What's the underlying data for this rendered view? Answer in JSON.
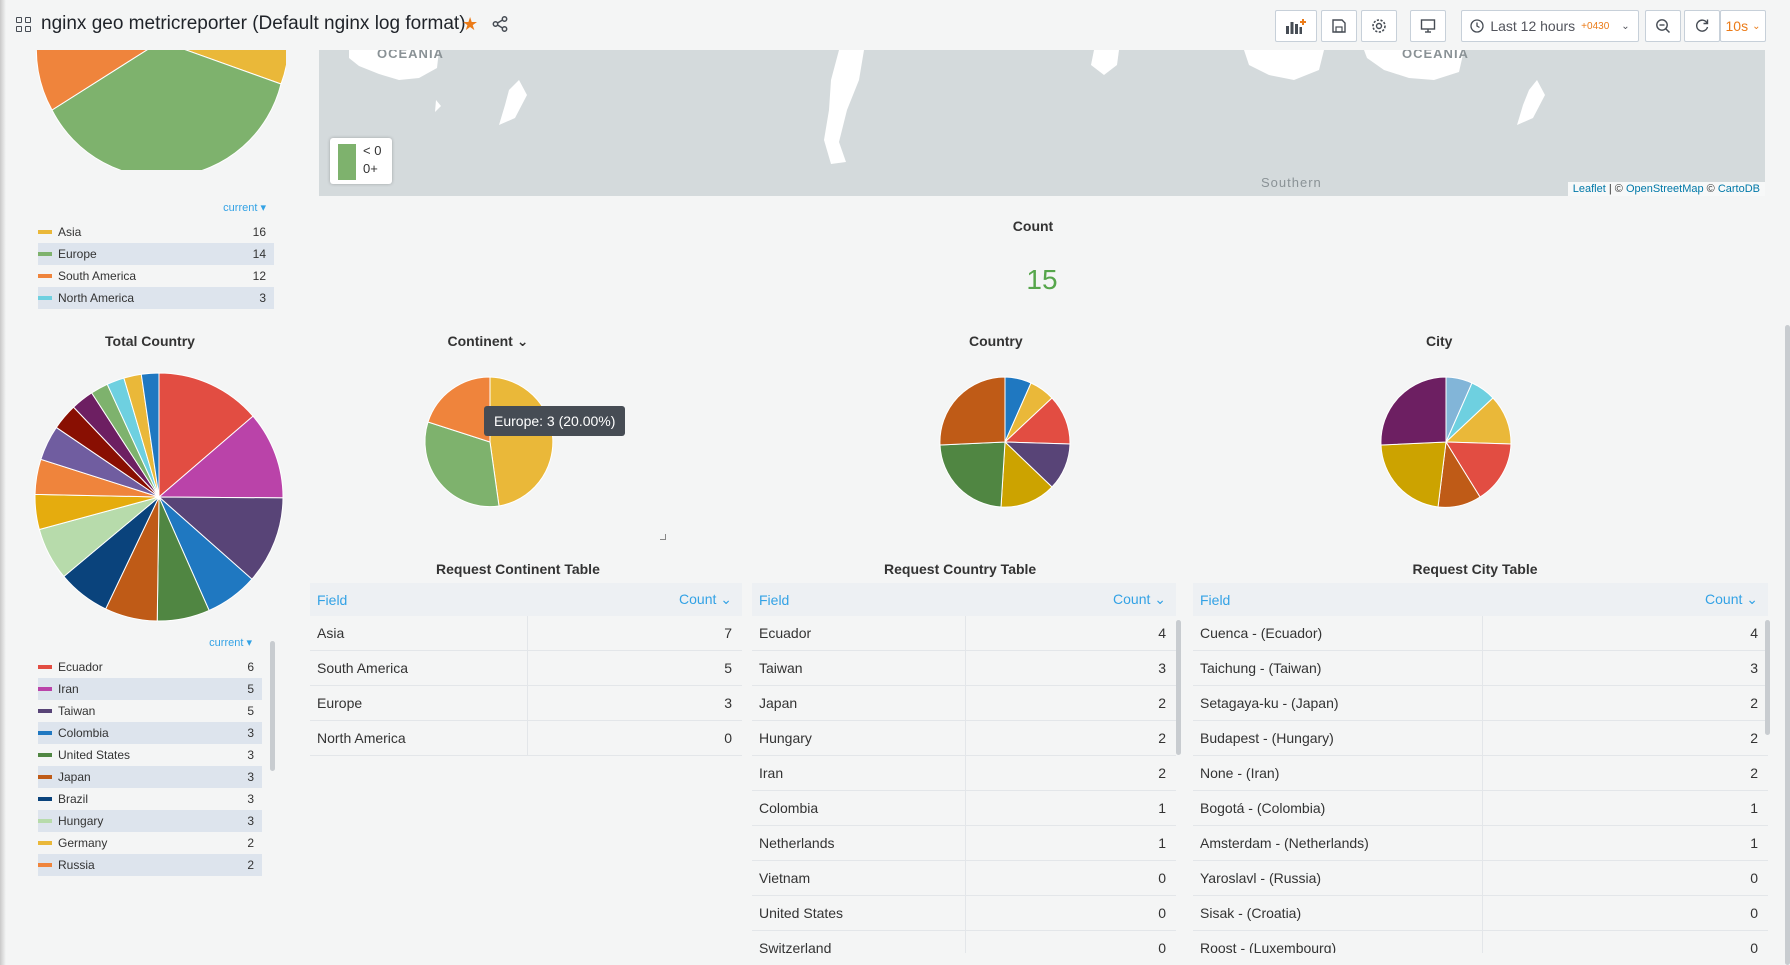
{
  "header": {
    "title": "nginx geo metricreporter (Default nginx log format)",
    "time_range": "Last 12 hours",
    "timezone": "+0430",
    "refresh": "10s"
  },
  "continent_legend": {
    "header": "current ▾",
    "items": [
      {
        "name": "Asia",
        "value": "16",
        "color": "#eab839"
      },
      {
        "name": "Europe",
        "value": "14",
        "color": "#7eb26d"
      },
      {
        "name": "South America",
        "value": "12",
        "color": "#ef843c"
      },
      {
        "name": "North America",
        "value": "3",
        "color": "#6ed0e0"
      }
    ]
  },
  "total_country": {
    "title": "Total Country",
    "legend_header": "current ▾",
    "items": [
      {
        "name": "Ecuador",
        "value": "6",
        "color": "#e24d42"
      },
      {
        "name": "Iran",
        "value": "5",
        "color": "#ba43a9"
      },
      {
        "name": "Taiwan",
        "value": "5",
        "color": "#584477"
      },
      {
        "name": "Colombia",
        "value": "3",
        "color": "#1f78c1"
      },
      {
        "name": "United States",
        "value": "3",
        "color": "#508642"
      },
      {
        "name": "Japan",
        "value": "3",
        "color": "#bf5b17"
      },
      {
        "name": "Brazil",
        "value": "3",
        "color": "#0a437c"
      },
      {
        "name": "Hungary",
        "value": "3",
        "color": "#b7dbab"
      },
      {
        "name": "Germany",
        "value": "2",
        "color": "#eab839"
      },
      {
        "name": "Russia",
        "value": "2",
        "color": "#ef843c"
      }
    ]
  },
  "map": {
    "label_left": "OCEANIA",
    "label_right": "OCEANIA",
    "label_south": "Southern",
    "legend": [
      "< 0",
      "0+"
    ],
    "attribution": {
      "leaflet": "Leaflet",
      "sep": " | © ",
      "osm": "OpenStreetMap",
      "sep2": " © ",
      "carto": "CartoDB"
    }
  },
  "count": {
    "title": "Count",
    "value": "15"
  },
  "panels": {
    "continent": "Continent ⌄",
    "country": "Country",
    "city": "City"
  },
  "tooltip": "Europe: 3 (20.00%)",
  "tables": {
    "continent": {
      "title": "Request Continent Table",
      "col_field": "Field",
      "col_count": "Count ⌄",
      "rows": [
        [
          "Asia",
          "7"
        ],
        [
          "South America",
          "5"
        ],
        [
          "Europe",
          "3"
        ],
        [
          "North America",
          "0"
        ]
      ]
    },
    "country": {
      "title": "Request Country Table",
      "col_field": "Field",
      "col_count": "Count ⌄",
      "rows": [
        [
          "Ecuador",
          "4"
        ],
        [
          "Taiwan",
          "3"
        ],
        [
          "Japan",
          "2"
        ],
        [
          "Hungary",
          "2"
        ],
        [
          "Iran",
          "2"
        ],
        [
          "Colombia",
          "1"
        ],
        [
          "Netherlands",
          "1"
        ],
        [
          "Vietnam",
          "0"
        ],
        [
          "United States",
          "0"
        ],
        [
          "Switzerland",
          "0"
        ]
      ]
    },
    "city": {
      "title": "Request City Table",
      "col_field": "Field",
      "col_count": "Count ⌄",
      "rows": [
        [
          "Cuenca - (Ecuador)",
          "4"
        ],
        [
          "Taichung - (Taiwan)",
          "3"
        ],
        [
          "Setagaya-ku - (Japan)",
          "2"
        ],
        [
          "Budapest - (Hungary)",
          "2"
        ],
        [
          "None - (Iran)",
          "2"
        ],
        [
          "Bogotá - (Colombia)",
          "1"
        ],
        [
          "Amsterdam - (Netherlands)",
          "1"
        ],
        [
          "Yaroslavl - (Russia)",
          "0"
        ],
        [
          "Sisak - (Croatia)",
          "0"
        ],
        [
          "Roost - (Luxembourg)",
          "0"
        ]
      ]
    }
  }
}
